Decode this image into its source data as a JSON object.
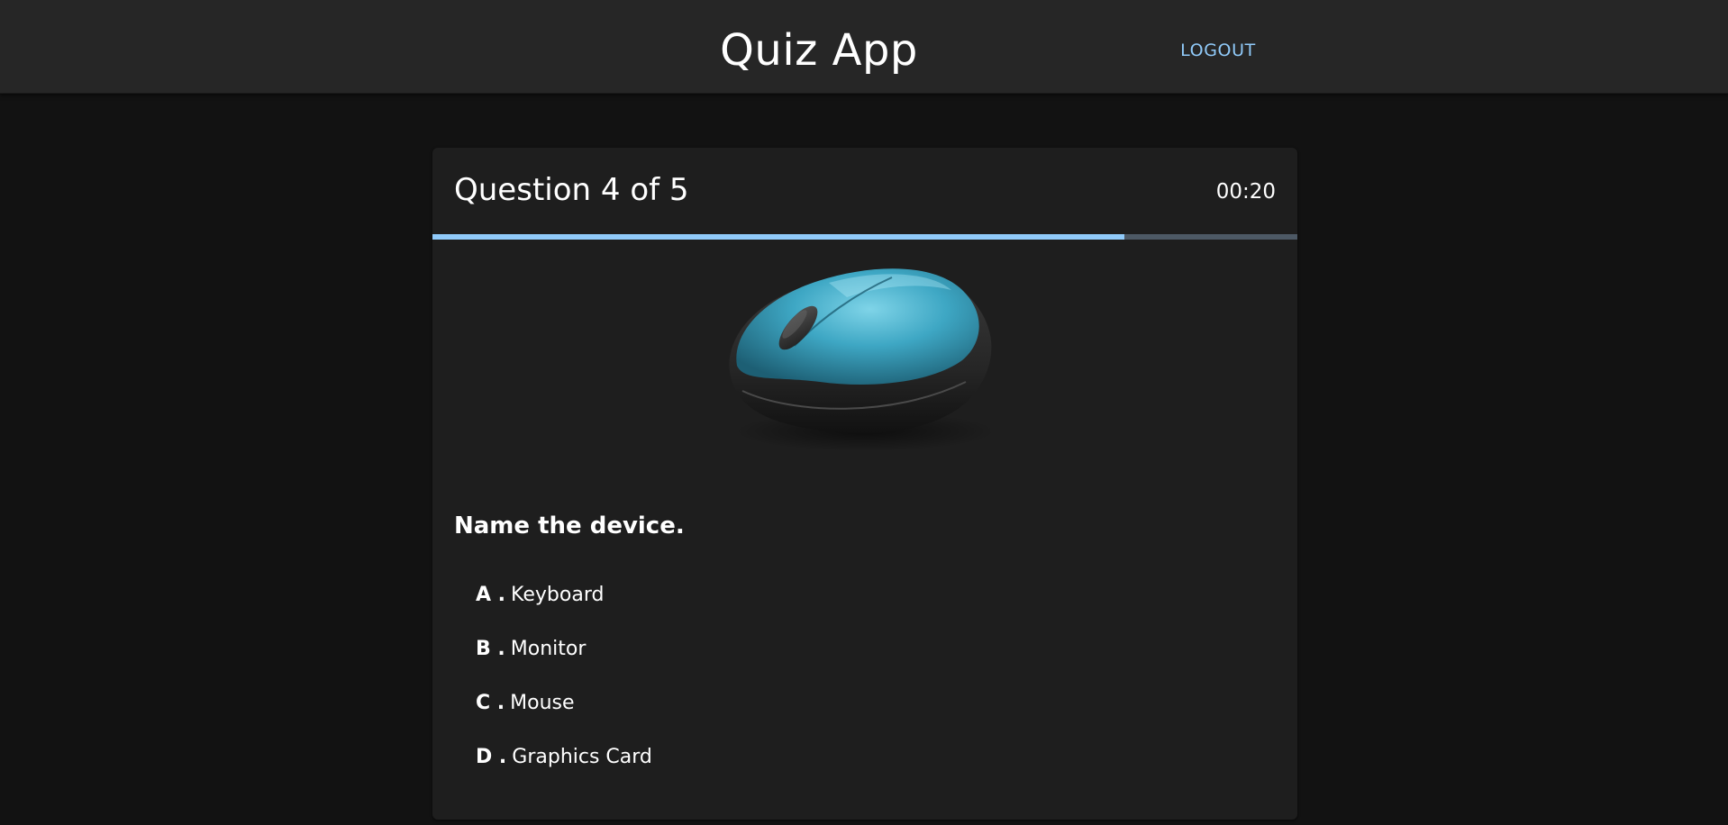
{
  "header": {
    "title": "Quiz App",
    "logout_label": "LOGOUT"
  },
  "quiz": {
    "counter": "Question 4 of 5",
    "timer": "00:20",
    "progress_fraction": 0.8,
    "image": {
      "icon": "computer-mouse-illustration",
      "body_color": "#3ea7c4",
      "base_color": "#2a2a2a"
    },
    "question": "Name the device.",
    "options": [
      {
        "letter": "A .",
        "text": "Keyboard"
      },
      {
        "letter": "B .",
        "text": "Monitor"
      },
      {
        "letter": "C .",
        "text": "Mouse"
      },
      {
        "letter": "D .",
        "text": "Graphics Card"
      }
    ]
  },
  "colors": {
    "background": "#121212",
    "appbar": "#262626",
    "card": "#1e1e1e",
    "accent": "#90caf9",
    "progress_track": "#4d5965"
  }
}
